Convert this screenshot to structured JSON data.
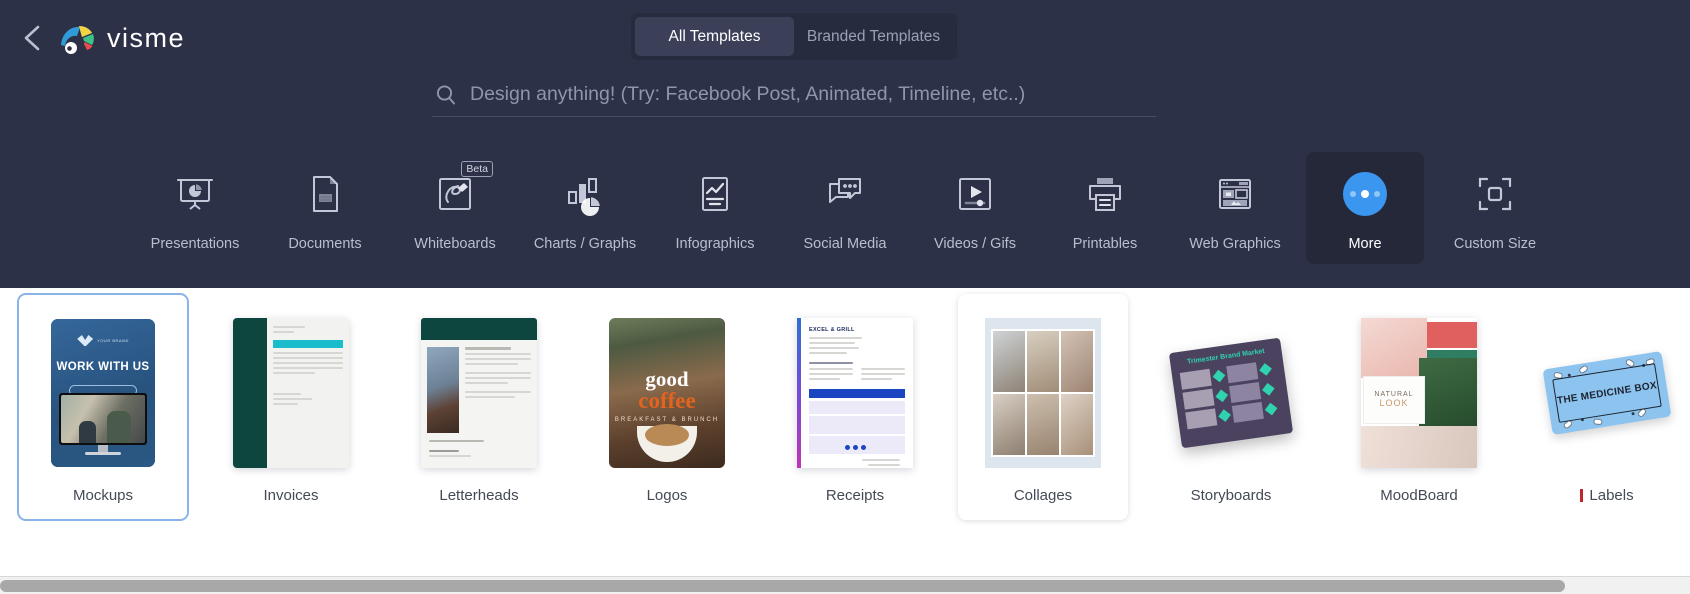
{
  "header": {
    "back_icon": "chevron-left-icon",
    "brand": "visme",
    "logo_icon": "visme-logo-icon"
  },
  "tabs": {
    "items": [
      {
        "label": "All Templates",
        "active": true
      },
      {
        "label": "Branded Templates",
        "active": false
      }
    ]
  },
  "search": {
    "icon": "search-icon",
    "value": "",
    "placeholder": "Design anything! (Try: Facebook Post, Animated, Timeline, etc..)"
  },
  "categories": [
    {
      "label": "Presentations",
      "icon": "presentation-screen-icon",
      "active": false,
      "badge": ""
    },
    {
      "label": "Documents",
      "icon": "document-page-icon",
      "active": false,
      "badge": ""
    },
    {
      "label": "Whiteboards",
      "icon": "whiteboard-pen-icon",
      "active": false,
      "badge": "Beta"
    },
    {
      "label": "Charts / Graphs",
      "icon": "bar-pie-chart-icon",
      "active": false,
      "badge": ""
    },
    {
      "label": "Infographics",
      "icon": "infographic-report-icon",
      "active": false,
      "badge": ""
    },
    {
      "label": "Social Media",
      "icon": "chat-bubbles-icon",
      "active": false,
      "badge": ""
    },
    {
      "label": "Videos / Gifs",
      "icon": "video-play-icon",
      "active": false,
      "badge": ""
    },
    {
      "label": "Printables",
      "icon": "printer-icon",
      "active": false,
      "badge": ""
    },
    {
      "label": "Web Graphics",
      "icon": "web-layout-icon",
      "active": false,
      "badge": ""
    },
    {
      "label": "More",
      "icon": "more-dots-icon",
      "active": true,
      "badge": ""
    },
    {
      "label": "Custom Size",
      "icon": "custom-size-frame-icon",
      "active": false,
      "badge": ""
    }
  ],
  "template_cards": [
    {
      "label": "Mockups",
      "state": "selected"
    },
    {
      "label": "Invoices",
      "state": "normal"
    },
    {
      "label": "Letterheads",
      "state": "normal"
    },
    {
      "label": "Logos",
      "state": "normal"
    },
    {
      "label": "Receipts",
      "state": "normal"
    },
    {
      "label": "Collages",
      "state": "hover"
    },
    {
      "label": "Storyboards",
      "state": "normal"
    },
    {
      "label": "MoodBoard",
      "state": "normal"
    },
    {
      "label": "Labels",
      "state": "normal"
    }
  ],
  "thumbnails": {
    "mockups_title": "WORK WITH US",
    "mockups_brand": "YOUR BRAND",
    "logos_word1": "good",
    "logos_word2": "coffee",
    "logos_sub": "BREAKFAST & BRUNCH",
    "receipts_title": "EXCEL & GRILL",
    "storyboards_title": "Trimester Brand Market",
    "moodboard_word1": "NATURAL",
    "moodboard_word2": "LOOK",
    "labels_text": "THE MEDICINE BOX"
  },
  "colors": {
    "panel_bg": "#2d3147",
    "tab_active_bg": "#3b4058",
    "accent_blue": "#3b96f0",
    "card_selected_border": "#8ab4e8",
    "caret_red": "#c0272d"
  }
}
